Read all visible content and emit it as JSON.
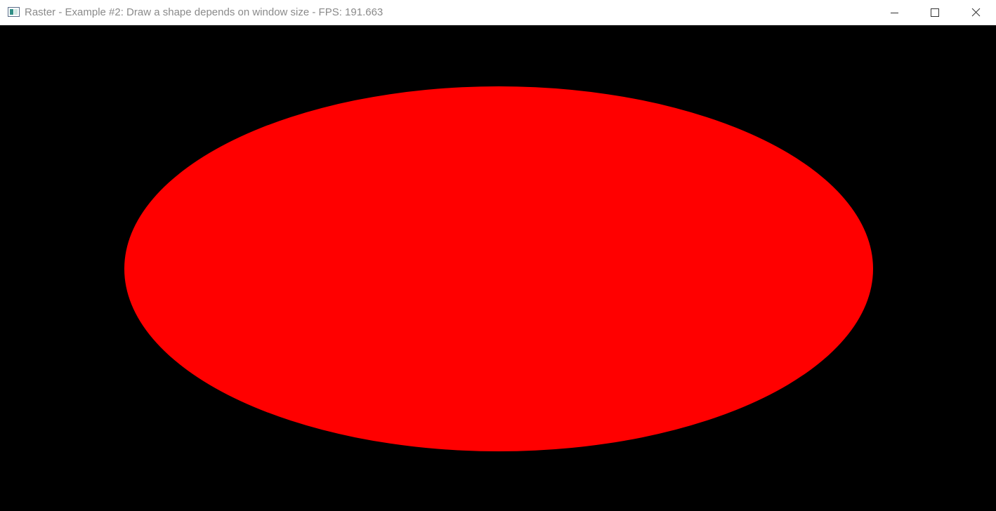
{
  "window": {
    "title": "Raster - Example #2: Draw a shape depends on window size - FPS: 191.663",
    "icon": "application-window-icon"
  },
  "controls": {
    "minimize_icon": "minimize-icon",
    "maximize_icon": "maximize-icon",
    "close_icon": "close-icon"
  },
  "canvas": {
    "background_color": "#000000",
    "shape": "ellipse",
    "shape_color": "#ff0000"
  }
}
